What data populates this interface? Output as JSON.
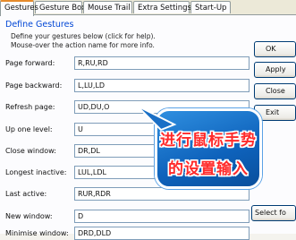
{
  "tabs": [
    {
      "label": "Gestures"
    },
    {
      "label": "Gesture Box"
    },
    {
      "label": "Mouse Trail"
    },
    {
      "label": "Extra Settings"
    },
    {
      "label": "Start-Up"
    }
  ],
  "group": {
    "title": "Define Gestures",
    "description_1": "Define your gestures below (click for help).",
    "description_2": "Mouse-over the action name for more info."
  },
  "rows": [
    {
      "label": "Page forward:",
      "value": "R,RU,RD"
    },
    {
      "label": "Page backward:",
      "value": "L,LU,LD"
    },
    {
      "label": "Refresh page:",
      "value": "UD,DU,O"
    },
    {
      "label": "Up one level:",
      "value": "U"
    },
    {
      "label": "Close window:",
      "value": "DR,DL"
    },
    {
      "label": "Longest inactive:",
      "value": "LUL,LDL"
    },
    {
      "label": "Last active:",
      "value": "RUR,RDR"
    },
    {
      "label": "New window:",
      "value": "D"
    },
    {
      "label": "Minimise window:",
      "value": "DRD,DLD"
    }
  ],
  "buttons": {
    "ok": "OK",
    "apply": "Apply",
    "close": "Close",
    "exit": "Exit",
    "select_font": "Select fo"
  },
  "callout": {
    "line1": "进行鼠标手势",
    "line2": "的设置输入"
  },
  "colors": {
    "tab_accent": "#e68b2c",
    "group_title": "#0046d5",
    "callout_bg": "#0e62bb",
    "callout_text": "#ff2a2a"
  }
}
